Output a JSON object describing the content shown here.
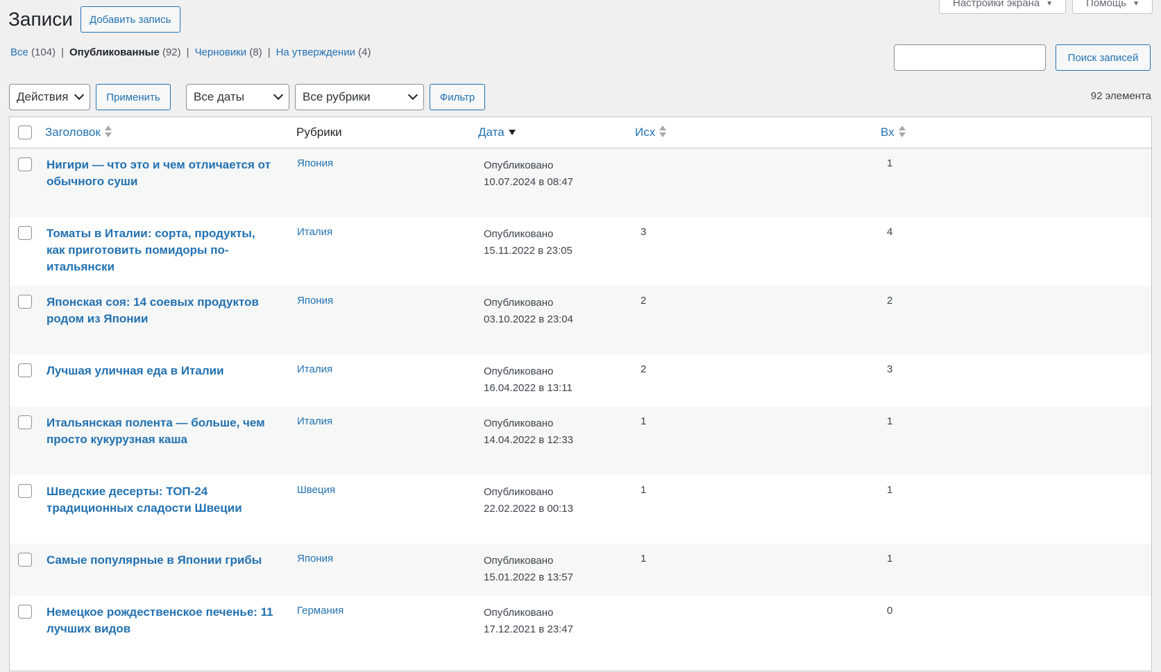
{
  "header": {
    "title": "Записи",
    "add_new_label": "Добавить запись",
    "screen_options_label": "Настройки экрана",
    "help_label": "Помощь"
  },
  "status_filter": {
    "all": {
      "label": "Все",
      "count": "(104)"
    },
    "published": {
      "label": "Опубликованные",
      "count": "(92)"
    },
    "drafts": {
      "label": "Черновики",
      "count": "(8)"
    },
    "pending": {
      "label": "На утверждении",
      "count": "(4)"
    },
    "separator": "|"
  },
  "search": {
    "value": "",
    "button_label": "Поиск записей"
  },
  "tablenav": {
    "bulk_actions": "Действия",
    "apply_label": "Применить",
    "dates_filter": "Все даты",
    "categories_filter": "Все рубрики",
    "filter_label": "Фильтр",
    "items_count": "92 элемента"
  },
  "columns": {
    "title": "Заголовок",
    "categories": "Рубрики",
    "date": "Дата",
    "outgoing": "Исх",
    "incoming": "Вх"
  },
  "rows": [
    {
      "title": "Нигири — что это и чем отличается от обычного суши",
      "category": "Япония",
      "status": "Опубликовано",
      "date": "10.07.2024 в 08:47",
      "out": "",
      "in": "1"
    },
    {
      "title": "Томаты в Италии: сорта, продукты, как приготовить помидоры по-итальянски",
      "category": "Италия",
      "status": "Опубликовано",
      "date": "15.11.2022 в 23:05",
      "out": "3",
      "in": "4"
    },
    {
      "title": "Японская соя: 14 соевых продуктов родом из Японии",
      "category": "Япония",
      "status": "Опубликовано",
      "date": "03.10.2022 в 23:04",
      "out": "2",
      "in": "2"
    },
    {
      "title": "Лучшая уличная еда в Италии",
      "category": "Италия",
      "status": "Опубликовано",
      "date": "16.04.2022 в 13:11",
      "out": "2",
      "in": "3"
    },
    {
      "title": "Итальянская полента — больше, чем просто кукурузная каша",
      "category": "Италия",
      "status": "Опубликовано",
      "date": "14.04.2022 в 12:33",
      "out": "1",
      "in": "1"
    },
    {
      "title": "Шведские десерты: ТОП-24 традиционных сладости Швеции",
      "category": "Швеция",
      "status": "Опубликовано",
      "date": "22.02.2022 в 00:13",
      "out": "1",
      "in": "1"
    },
    {
      "title": "Самые популярные в Японии грибы",
      "category": "Япония",
      "status": "Опубликовано",
      "date": "15.01.2022 в 13:57",
      "out": "1",
      "in": "1"
    },
    {
      "title": "Немецкое рождественское печенье: 11 лучших видов",
      "category": "Германия",
      "status": "Опубликовано",
      "date": "17.12.2021 в 23:47",
      "out": "",
      "in": "0"
    }
  ]
}
